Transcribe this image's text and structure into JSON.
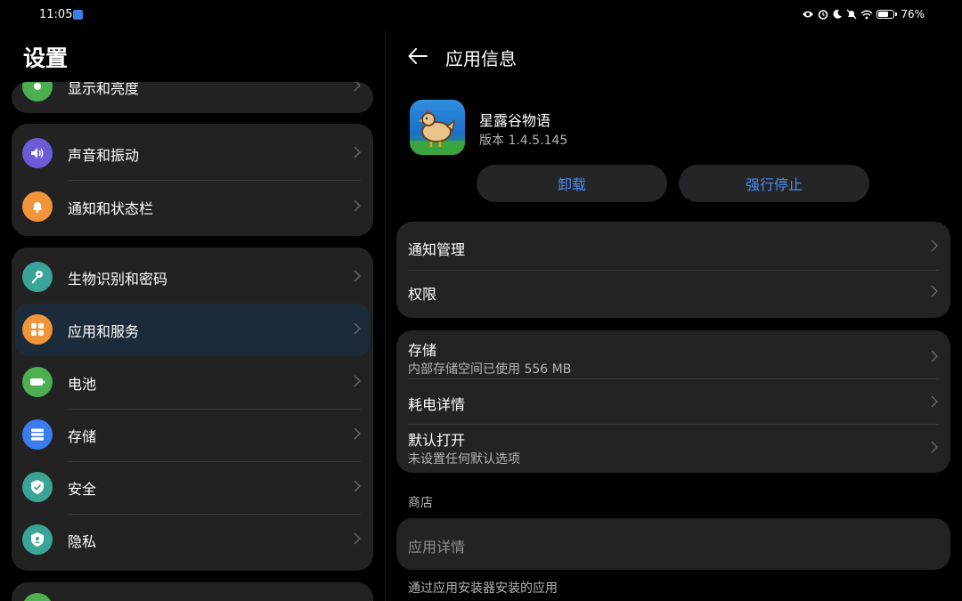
{
  "status_bar": {
    "time": "11:05",
    "battery": "76%",
    "battery_level": 0.76
  },
  "left": {
    "title": "设置",
    "items": [
      {
        "label": "显示和亮度",
        "icon": "display-icon",
        "color": "#4caf50"
      },
      {
        "label": "声音和振动",
        "icon": "speaker-icon",
        "color": "#6b5bd6"
      },
      {
        "label": "通知和状态栏",
        "icon": "bell-icon",
        "color": "#f0953a"
      },
      {
        "label": "生物识别和密码",
        "icon": "key-icon",
        "color": "#3aa596"
      },
      {
        "label": "应用和服务",
        "icon": "apps-grid-icon",
        "color": "#f0953a"
      },
      {
        "label": "电池",
        "icon": "battery-icon",
        "color": "#4caf50"
      },
      {
        "label": "存储",
        "icon": "storage-icon",
        "color": "#3b7cf0"
      },
      {
        "label": "安全",
        "icon": "shield-icon",
        "color": "#3aa596"
      },
      {
        "label": "隐私",
        "icon": "privacy-icon",
        "color": "#3aa596"
      }
    ]
  },
  "right": {
    "title": "应用信息",
    "app": {
      "name": "星露谷物语",
      "version": "版本 1.4.5.145"
    },
    "buttons": {
      "uninstall": "卸载",
      "force_stop": "强行停止"
    },
    "group1": [
      {
        "title": "通知管理"
      },
      {
        "title": "权限"
      }
    ],
    "group2": [
      {
        "title": "存储",
        "subtitle": "内部存储空间已使用 556 MB"
      },
      {
        "title": "耗电详情"
      },
      {
        "title": "默认打开",
        "subtitle": "未设置任何默认选项"
      }
    ],
    "store_section": "商店",
    "app_details": "应用详情",
    "install_source": "通过应用安装器安装的应用"
  },
  "colors": {
    "accent": "#4a8cf2",
    "card": "#222223",
    "selected": "#1c2b3a"
  }
}
